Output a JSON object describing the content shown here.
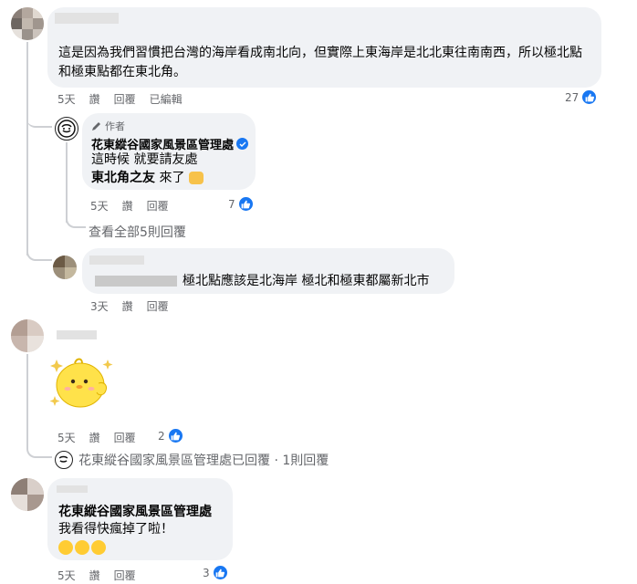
{
  "comments": [
    {
      "text": "這是因為我們習慣把台灣的海岸看成南北向，但實際上東海岸是北北東往南南西，所以極北點和極東點都在東北角。",
      "time": "5天",
      "like_label": "讚",
      "reply_label": "回覆",
      "edited_label": "已編輯",
      "reaction_count": "27"
    },
    {
      "author_badge": "作者",
      "author": "花東縱谷國家風景區管理處",
      "line1": "這時候 就要請友處",
      "line2_bold": "東北角之友",
      "line2_rest": " 來了",
      "time": "5天",
      "like_label": "讚",
      "reply_label": "回覆",
      "reaction_count": "7"
    },
    {
      "view_all_label": "查看全部5則回覆"
    },
    {
      "text": "極北點應該是北海岸 極北和極東都屬新北市",
      "time": "3天",
      "like_label": "讚",
      "reply_label": "回覆"
    },
    {
      "time": "5天",
      "like_label": "讚",
      "reply_label": "回覆",
      "reaction_count": "2",
      "reply_summary": "花東縱谷國家風景區管理處已回覆 · 1則回覆"
    },
    {
      "quoted_author": "花東縱谷國家風景區管理處",
      "text": "我看得快瘋掉了啦！",
      "time": "5天",
      "like_label": "讚",
      "reply_label": "回覆",
      "reaction_count": "3"
    }
  ],
  "colors": {
    "like_blue": "#1877f2",
    "verified_blue": "#1877f2",
    "meta_gray": "#65676b",
    "bubble_bg": "#f0f2f5"
  }
}
